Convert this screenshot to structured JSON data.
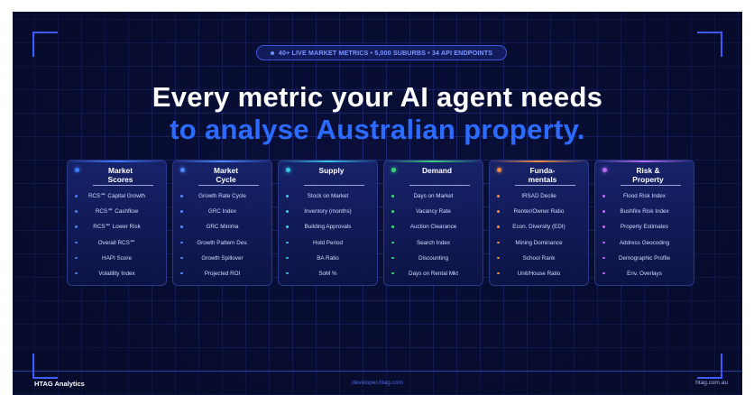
{
  "badge": "40+ LIVE MARKET METRICS • 5,000 SUBURBS • 34 API ENDPOINTS",
  "headline_line1": "Every metric your AI agent needs",
  "headline_line2": "to analyse Australian property.",
  "colors": {
    "background": "#0a0f3a",
    "accent_blue": "#2c6bff",
    "grid": "#3a4ec8"
  },
  "cards": [
    {
      "title": "Market\nScores",
      "accent": "#3f7dff",
      "items": [
        "RCS℠ Capital Growth",
        "RCS℠ Cashflow",
        "RCS℠ Lower Risk",
        "Overall RCS℠",
        "HAPI Score",
        "Volatility Index"
      ]
    },
    {
      "title": "Market\nCycle",
      "accent": "#4f88ff",
      "items": [
        "Growth Rate Cycle",
        "GRC Index",
        "GRC Minima",
        "Growth Pattern Dev.",
        "Growth Spillover",
        "Projected ROI"
      ]
    },
    {
      "title": "Supply",
      "accent": "#35c6e8",
      "items": [
        "Stock on Market",
        "Inventory (months)",
        "Building Approvals",
        "Hold Period",
        "BA Ratio",
        "SoM %"
      ]
    },
    {
      "title": "Demand",
      "accent": "#39d27a",
      "items": [
        "Days on Market",
        "Vacancy Rate",
        "Auction Clearance",
        "Search Index",
        "Discounting",
        "Days on Rental Mkt"
      ]
    },
    {
      "title": "Funda-\nmentals",
      "accent": "#f08a3e",
      "items": [
        "IRSAD Decile",
        "Renter/Owner Ratio",
        "Econ. Diversity (EDI)",
        "Mining Dominance",
        "School Rank",
        "Unit/House Ratio"
      ]
    },
    {
      "title": "Risk &\nProperty",
      "accent": "#b66cf0",
      "items": [
        "Flood Risk Index",
        "Bushfire Risk Index",
        "Property Estimates",
        "Address Geocoding",
        "Demographic Profile",
        "Env. Overlays"
      ]
    }
  ],
  "footer": {
    "brand": "HTAG Analytics",
    "url": "developer.htag.com",
    "site": "htag.com.au"
  }
}
